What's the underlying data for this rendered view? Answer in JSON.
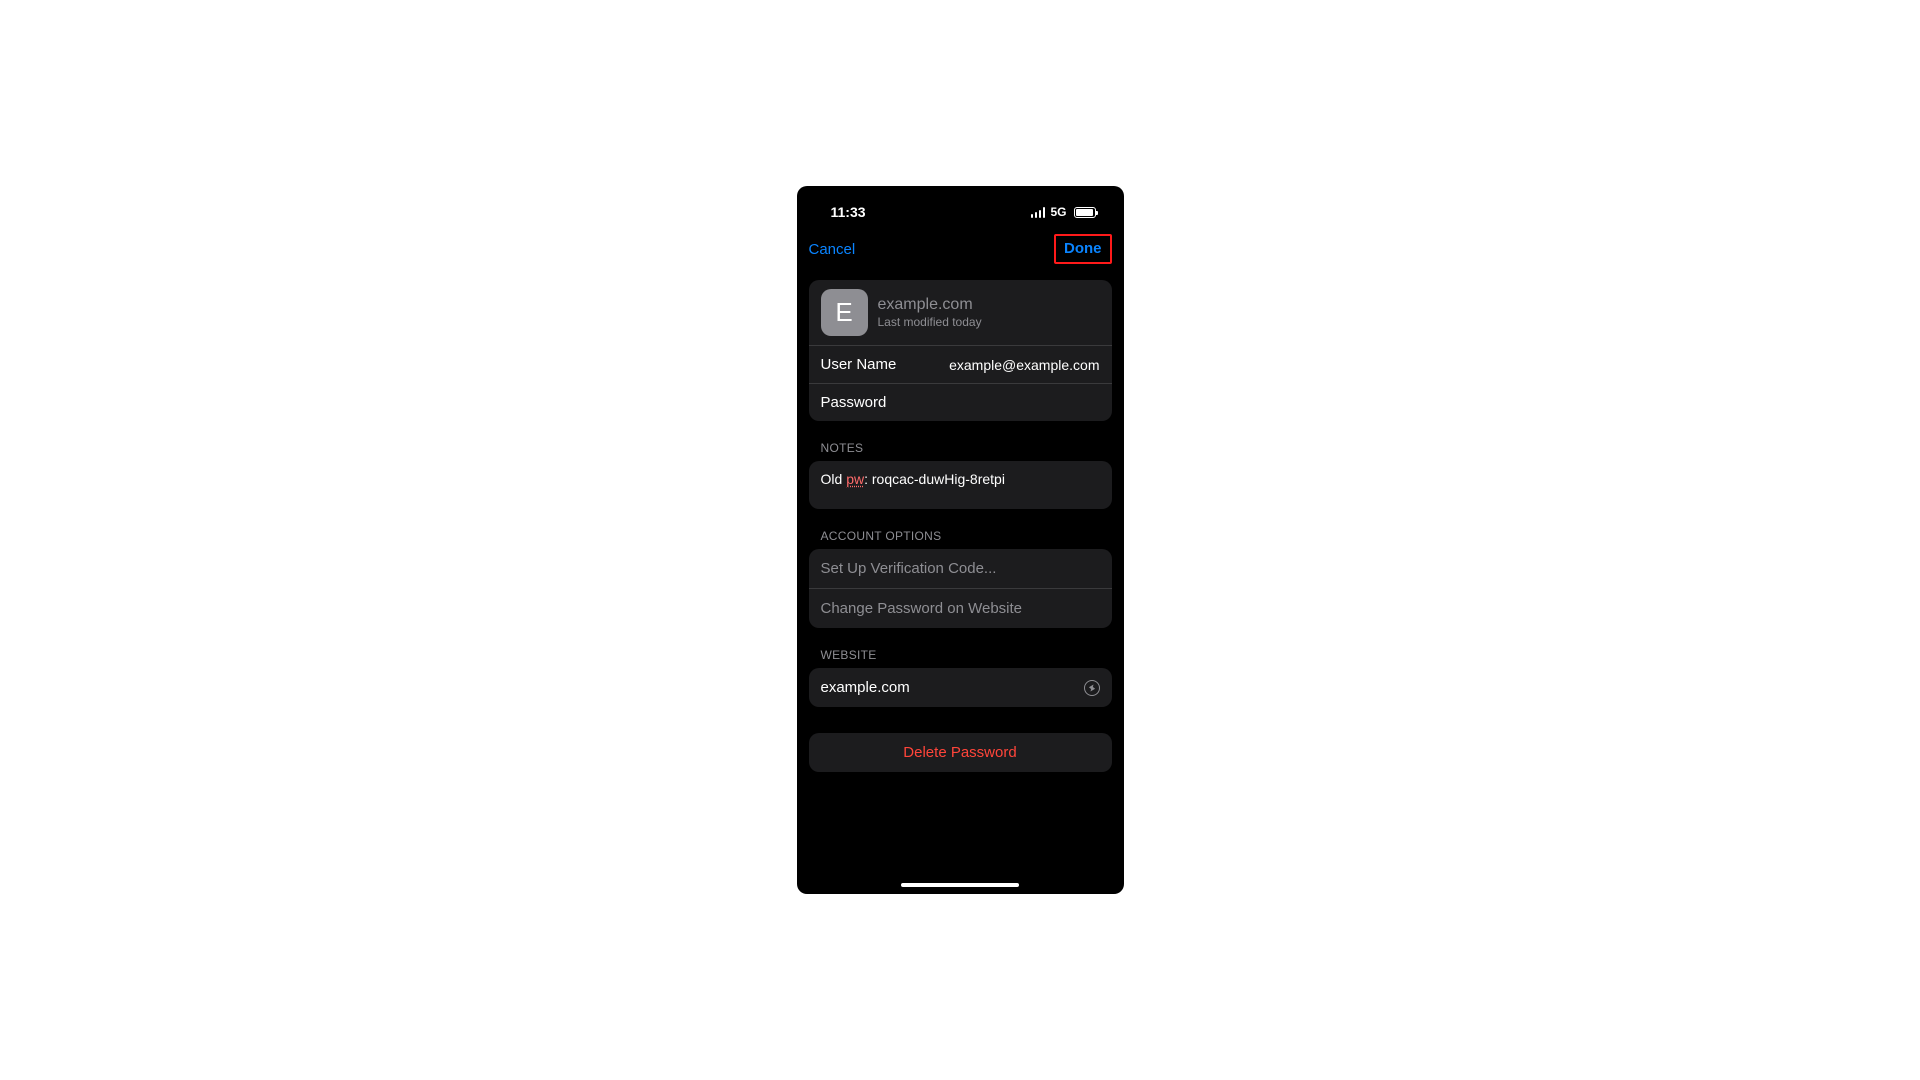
{
  "statusBar": {
    "time": "11:33",
    "network": "5G"
  },
  "nav": {
    "cancel": "Cancel",
    "done": "Done"
  },
  "header": {
    "initial": "E",
    "site": "example.com",
    "modified": "Last modified today"
  },
  "fields": {
    "usernameLabel": "User Name",
    "usernameValue": "example@example.com",
    "passwordLabel": "Password"
  },
  "sections": {
    "notes": "NOTES",
    "accountOptions": "ACCOUNT OPTIONS",
    "website": "WEBSITE"
  },
  "notes": {
    "prefix": "Old ",
    "pwWord": "pw",
    "suffix": ": roqcac-duwHig-8retpi"
  },
  "options": {
    "verification": "Set Up Verification Code...",
    "changePassword": "Change Password on Website"
  },
  "website": {
    "value": "example.com"
  },
  "delete": {
    "label": "Delete Password"
  }
}
